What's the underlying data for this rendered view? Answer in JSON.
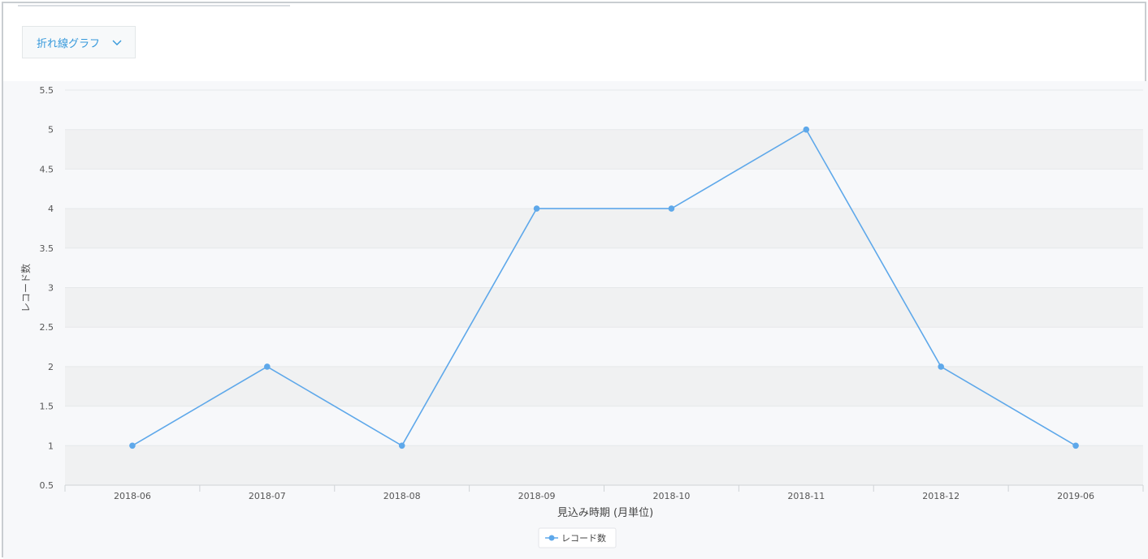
{
  "toolbar": {
    "chart_type_label": "折れ線グラフ",
    "chevron_icon": "chevron-down-icon"
  },
  "colors": {
    "series": "#5ea8ea",
    "accent": "#3498db",
    "band": "#f0f1f2",
    "plot_bg": "#f7f8fa"
  },
  "chart_data": {
    "type": "line",
    "categories": [
      "2018-06",
      "2018-07",
      "2018-08",
      "2018-09",
      "2018-10",
      "2018-11",
      "2018-12",
      "2019-06"
    ],
    "series": [
      {
        "name": "レコード数",
        "values": [
          1,
          2,
          1,
          4,
          4,
          5,
          2,
          1
        ]
      }
    ],
    "xlabel": "見込み時期 (月単位)",
    "ylabel": "レコード数",
    "ylim": [
      0.5,
      5.5
    ],
    "yticks": [
      "0.5",
      "1",
      "1.5",
      "2",
      "2.5",
      "3",
      "3.5",
      "4",
      "4.5",
      "5",
      "5.5"
    ],
    "grid": true,
    "legend": "bottom-center"
  }
}
